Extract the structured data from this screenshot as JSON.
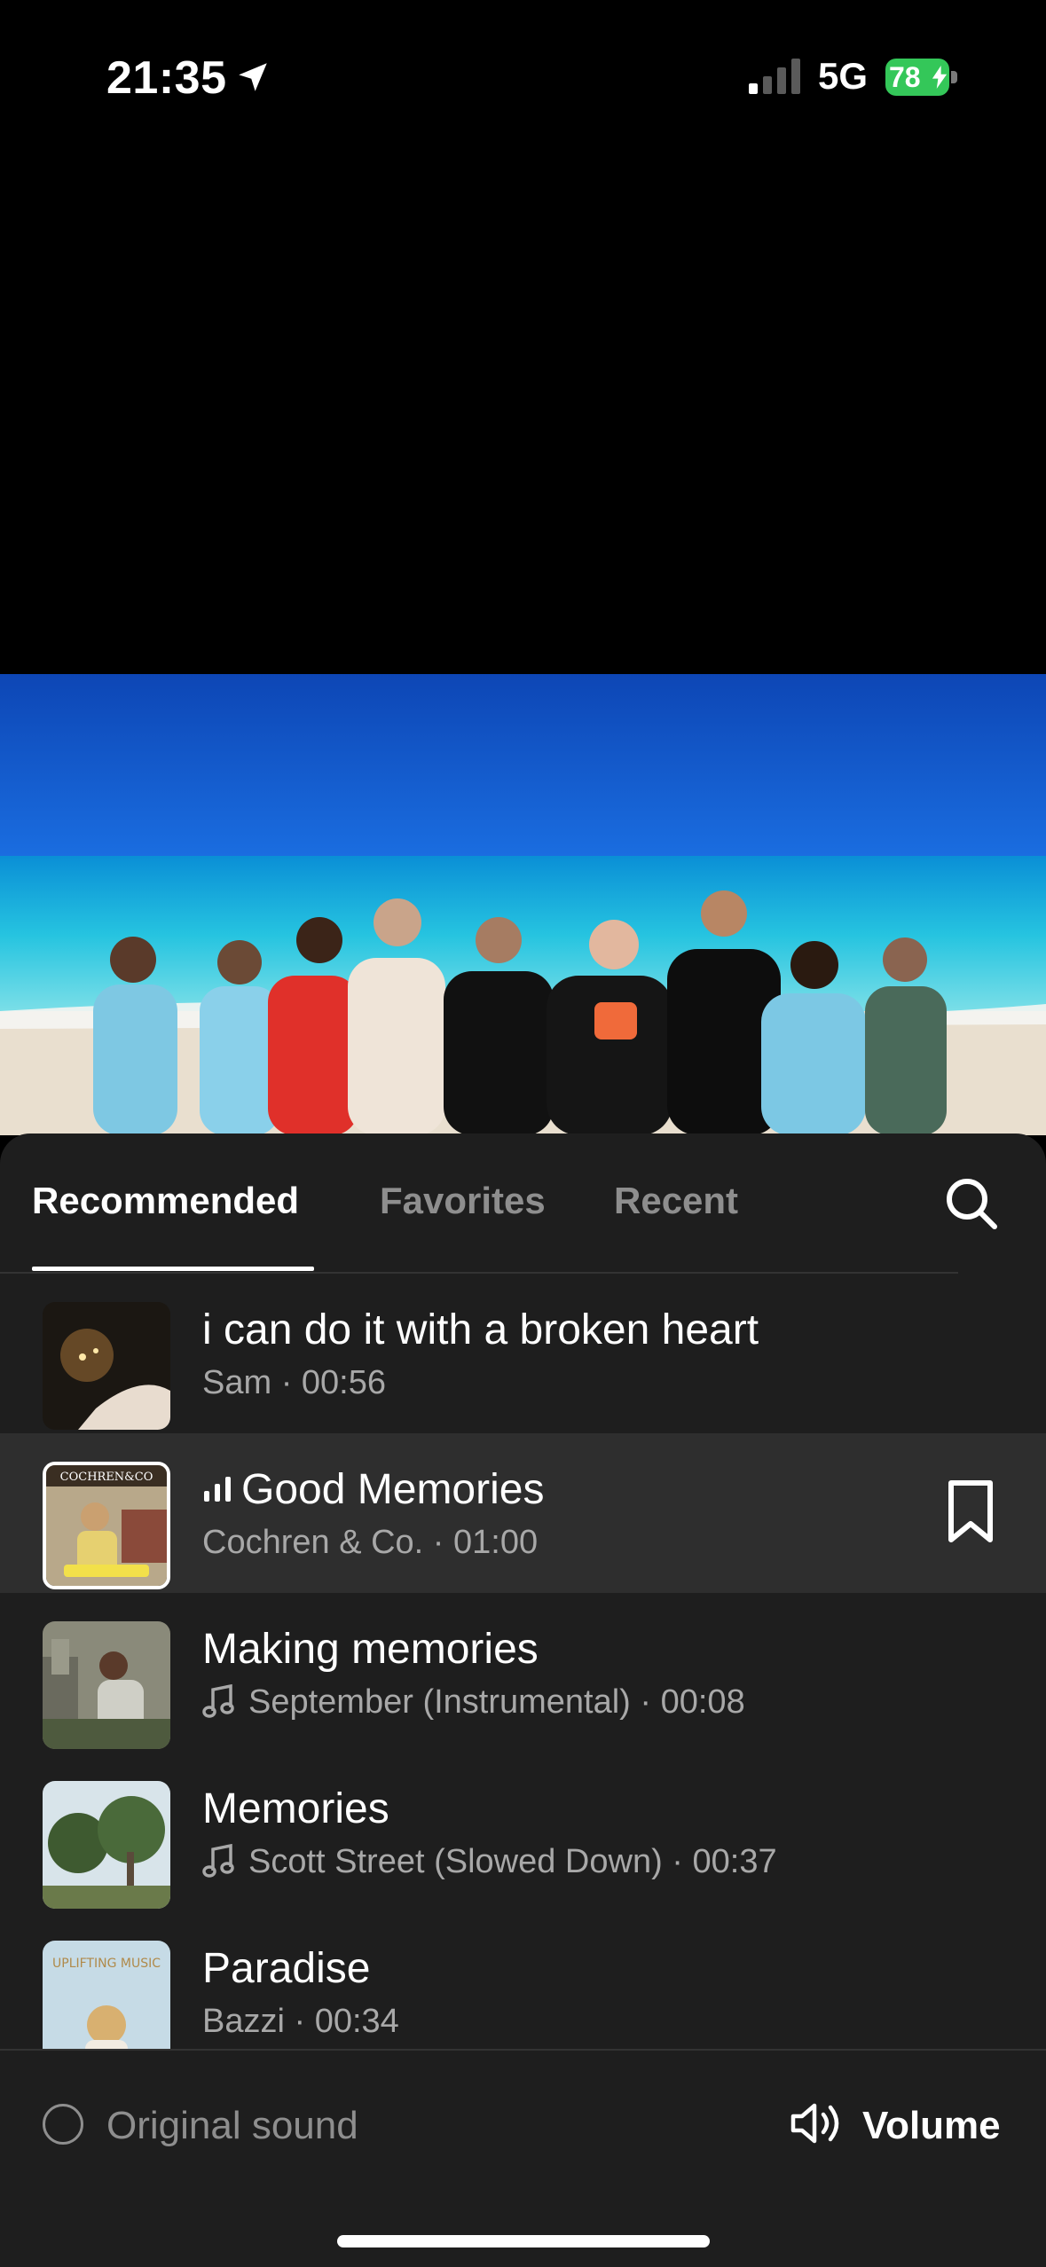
{
  "status_bar": {
    "time": "21:35",
    "network": "5G",
    "battery": "78"
  },
  "photo": {
    "description_icon": "group-photo-beach"
  },
  "tabs": [
    {
      "label": "Recommended",
      "active": true
    },
    {
      "label": "Favorites",
      "active": false
    },
    {
      "label": "Recent",
      "active": false
    }
  ],
  "songs": [
    {
      "title": "i can do it with a broken heart",
      "subtitle": "Sam · 00:56",
      "selected": false
    },
    {
      "title": "Good Memories",
      "subtitle": "Cochren & Co. · 01:00",
      "selected": true,
      "thumb_text": "COCHREN&CO"
    },
    {
      "title": "Making memories",
      "subtitle": "September (Instrumental) · 00:08",
      "selected": false
    },
    {
      "title": "Memories",
      "subtitle": "Scott Street (Slowed Down) · 00:37",
      "selected": false
    },
    {
      "title": "Paradise",
      "subtitle": "Bazzi · 00:34",
      "selected": false,
      "thumb_text": "UPLIFTING MUSIC"
    }
  ],
  "bottom": {
    "original_sound_label": "Original sound",
    "volume_label": "Volume"
  },
  "colors": {
    "battery": "#34c759",
    "sheet_bg": "#1e1e1e",
    "selected_row": "#2e2e2e",
    "muted_text": "#8e8e8e"
  }
}
